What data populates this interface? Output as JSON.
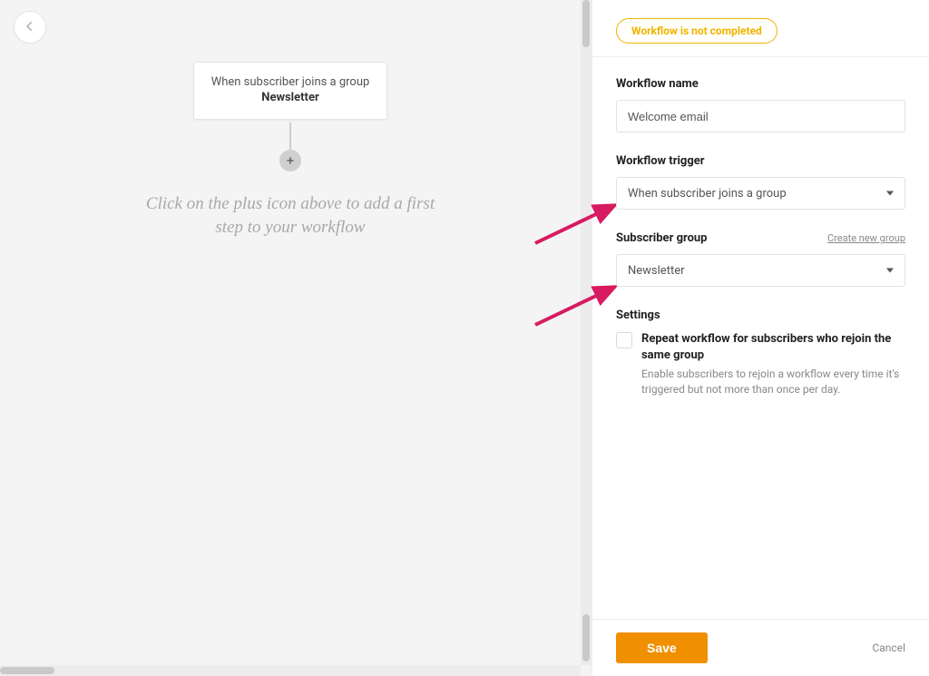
{
  "canvas": {
    "trigger_line1": "When subscriber joins a group",
    "trigger_line2": "Newsletter",
    "hint_line1": "Click on the plus icon above to add a first",
    "hint_line2": "step to your workflow"
  },
  "panel": {
    "status_badge": "Workflow is not completed",
    "name_label": "Workflow name",
    "name_value": "Welcome email",
    "trigger_label": "Workflow trigger",
    "trigger_value": "When subscriber joins a group",
    "group_label": "Subscriber group",
    "group_create_link": "Create new group",
    "group_value": "Newsletter",
    "settings_label": "Settings",
    "repeat_label": "Repeat workflow for subscribers who rejoin the same group",
    "repeat_desc": "Enable subscribers to rejoin a workflow every time it's triggered but not more than once per day."
  },
  "footer": {
    "save": "Save",
    "cancel": "Cancel"
  },
  "colors": {
    "accent_orange": "#f09000",
    "badge_yellow": "#f0b400",
    "arrow_pink": "#d81b60"
  }
}
